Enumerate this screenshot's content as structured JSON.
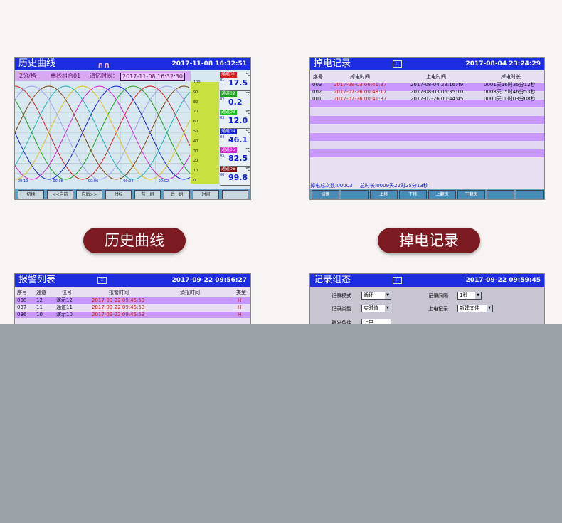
{
  "panels": {
    "history": {
      "title": "历史曲线",
      "date": "2017-11-08 16:32:51",
      "sub_rate": "2分/格",
      "sub_group": "曲线组合01",
      "sub_trace_label": "追忆时间：",
      "sub_trace_time": "2017-11-08 16:32:30",
      "x_ticks": [
        "00:10",
        "00:08",
        "00:06",
        "00:04",
        "00:02"
      ],
      "y_ticks": [
        "100",
        "90",
        "80",
        "70",
        "60",
        "50",
        "40",
        "30",
        "20",
        "10",
        "0"
      ],
      "channels": [
        {
          "tag": "通道01",
          "num": "01",
          "value": "17.5",
          "unit": "℃",
          "color": "#d02020"
        },
        {
          "tag": "通道02",
          "num": "02",
          "value": "0.2",
          "unit": "℃",
          "color": "#20a020"
        },
        {
          "tag": "通道03",
          "num": "03",
          "value": "12.0",
          "unit": "℃",
          "color": "#20c020"
        },
        {
          "tag": "通道04",
          "num": "04",
          "value": "46.1",
          "unit": "℃",
          "color": "#1020d0"
        },
        {
          "tag": "通道05",
          "num": "05",
          "value": "82.5",
          "unit": "℃",
          "color": "#d020d0"
        },
        {
          "tag": "通道06",
          "num": "06",
          "value": "99.8",
          "unit": "℃",
          "color": "#801010"
        }
      ],
      "buttons": [
        "切换",
        "<<向前",
        "向后>>",
        "时标",
        "前一组",
        "后一组",
        "时间",
        ""
      ],
      "caption": "历史曲线"
    },
    "power": {
      "title": "掉电记录",
      "date": "2017-08-04 23:24:29",
      "headers": [
        "序号",
        "掉电时间",
        "上电时间",
        "掉电时长"
      ],
      "rows": [
        [
          "003",
          "2017-08-03 06:41:37",
          "2017-08-04 23:16:49",
          "0001天16时35分12秒"
        ],
        [
          "002",
          "2017-07-26 00:48:17",
          "2017-08-03 06:35:10",
          "0008天05时46分53秒"
        ],
        [
          "001",
          "2017-07-26 00:41:37",
          "2017-07-26 00:44:45",
          "0000天00时03分08秒"
        ]
      ],
      "footer_count": "掉电总次数:00003",
      "footer_total": "总时长:0009天22时25分13秒",
      "buttons": [
        "切换",
        "",
        "上移",
        "下移",
        "上翻页",
        "下翻页",
        "",
        ""
      ],
      "caption": "掉电记录"
    },
    "alarm": {
      "title": "报警列表",
      "date": "2017-09-22 09:56:27",
      "headers": [
        "序号",
        "通道",
        "位号",
        "报警时间",
        "消报时间",
        "类型"
      ],
      "rows": [
        [
          "038",
          "12",
          "演示12",
          "2017-09-22 09:45:53",
          "",
          "H"
        ],
        [
          "037",
          "11",
          "通道11",
          "2017-09-22 09:45:53",
          "",
          "H"
        ],
        [
          "036",
          "10",
          "演示10",
          "2017-09-22 09:45:53",
          "",
          "H"
        ]
      ]
    },
    "record": {
      "title": "记录组态",
      "date": "2017-09-22 09:59:45",
      "fields": {
        "mode_label": "记录模式",
        "mode_value": "循环",
        "interval_label": "记录间隔",
        "interval_value": "1秒",
        "type_label": "记录类型",
        "type_value": "实时值",
        "power_label": "上电记录",
        "power_value": "新建文件",
        "trigger_label": "触发条件",
        "trigger_value": "上电"
      }
    }
  },
  "colors": {
    "title_bar": "#1c2ce0",
    "caption_bg": "#7c1a22",
    "overlay": "#9aa1a7"
  }
}
